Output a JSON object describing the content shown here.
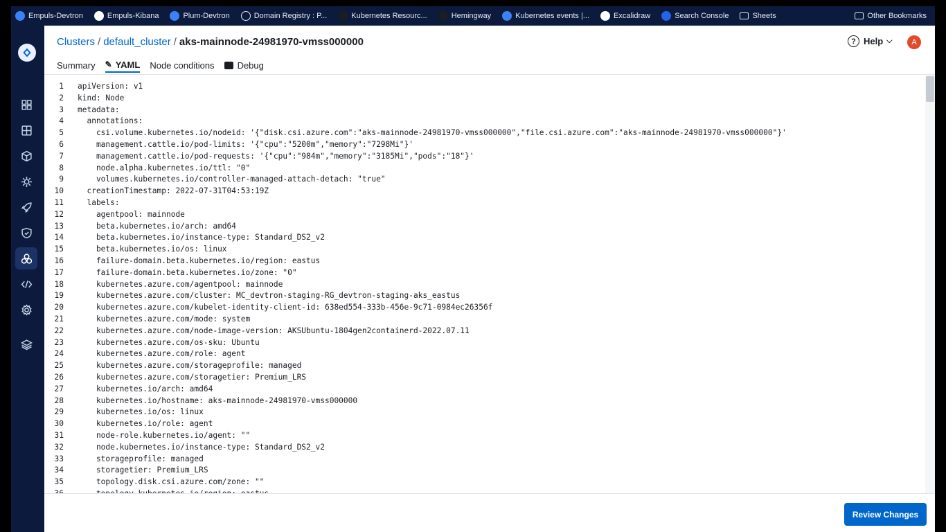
{
  "bookmarks": [
    {
      "label": "Empuls-Devtron",
      "icon": "empuls-icon",
      "color": "#3b82f6"
    },
    {
      "label": "Empuls-Kibana",
      "icon": "kibana-icon",
      "color": "#ffffff"
    },
    {
      "label": "Plum-Devtron",
      "icon": "devtron-icon",
      "color": "#3b82f6"
    },
    {
      "label": "Domain Registry : P...",
      "icon": "globe-icon",
      "color": ""
    },
    {
      "label": "Kubernetes Resourc...",
      "icon": "k8s-icon",
      "color": "#1a1d23"
    },
    {
      "label": "Hemingway",
      "icon": "hemingway-icon",
      "color": "#1a1d23"
    },
    {
      "label": "Kubernetes events |...",
      "icon": "events-icon",
      "color": "#3b82f6"
    },
    {
      "label": "Excalidraw",
      "icon": "excalidraw-icon",
      "color": "#ffffff"
    },
    {
      "label": "Search Console",
      "icon": "search-console-icon",
      "color": "#2563eb"
    },
    {
      "label": "Sheets",
      "icon": "folder-icon",
      "color": ""
    }
  ],
  "other_bookmarks": "Other Bookmarks",
  "breadcrumb": {
    "clusters": "Clusters",
    "sep1": "/",
    "cluster": "default_cluster",
    "sep2": "/",
    "node": "aks-mainnode-24981970-vmss000000"
  },
  "help_label": "Help",
  "avatar_initial": "A",
  "tabs": {
    "summary": "Summary",
    "yaml": "YAML",
    "node_conditions": "Node conditions",
    "debug": "Debug"
  },
  "yaml_lines": [
    "apiVersion: v1",
    "kind: Node",
    "metadata:",
    "  annotations:",
    "    csi.volume.kubernetes.io/nodeid: '{\"disk.csi.azure.com\":\"aks-mainnode-24981970-vmss000000\",\"file.csi.azure.com\":\"aks-mainnode-24981970-vmss000000\"}'",
    "    management.cattle.io/pod-limits: '{\"cpu\":\"5200m\",\"memory\":\"7298Mi\"}'",
    "    management.cattle.io/pod-requests: '{\"cpu\":\"984m\",\"memory\":\"3185Mi\",\"pods\":\"18\"}'",
    "    node.alpha.kubernetes.io/ttl: \"0\"",
    "    volumes.kubernetes.io/controller-managed-attach-detach: \"true\"",
    "  creationTimestamp: 2022-07-31T04:53:19Z",
    "  labels:",
    "    agentpool: mainnode",
    "    beta.kubernetes.io/arch: amd64",
    "    beta.kubernetes.io/instance-type: Standard_DS2_v2",
    "    beta.kubernetes.io/os: linux",
    "    failure-domain.beta.kubernetes.io/region: eastus",
    "    failure-domain.beta.kubernetes.io/zone: \"0\"",
    "    kubernetes.azure.com/agentpool: mainnode",
    "    kubernetes.azure.com/cluster: MC_devtron-staging-RG_devtron-staging-aks_eastus",
    "    kubernetes.azure.com/kubelet-identity-client-id: 638ed554-333b-456e-9c71-0984ec26356f",
    "    kubernetes.azure.com/mode: system",
    "    kubernetes.azure.com/node-image-version: AKSUbuntu-1804gen2containerd-2022.07.11",
    "    kubernetes.azure.com/os-sku: Ubuntu",
    "    kubernetes.azure.com/role: agent",
    "    kubernetes.azure.com/storageprofile: managed",
    "    kubernetes.azure.com/storagetier: Premium_LRS",
    "    kubernetes.io/arch: amd64",
    "    kubernetes.io/hostname: aks-mainnode-24981970-vmss000000",
    "    kubernetes.io/os: linux",
    "    kubernetes.io/role: agent",
    "    node-role.kubernetes.io/agent: \"\"",
    "    node.kubernetes.io/instance-type: Standard_DS2_v2",
    "    storageprofile: managed",
    "    storagetier: Premium_LRS",
    "    topology.disk.csi.azure.com/zone: \"\"",
    "    topology.kubernetes.io/region: eastus"
  ],
  "review_button": "Review Changes",
  "colors": {
    "nav_bg": "#0b1a3d",
    "accent": "#0066cc",
    "avatar": "#e44a2a"
  },
  "nav_icons": [
    "apps-icon",
    "app-groups-icon",
    "resource-browser-icon",
    "global-config-icon",
    "deploy-icon",
    "security-icon",
    "cluster-icon",
    "code-icon",
    "settings-icon",
    "stack-icon"
  ]
}
